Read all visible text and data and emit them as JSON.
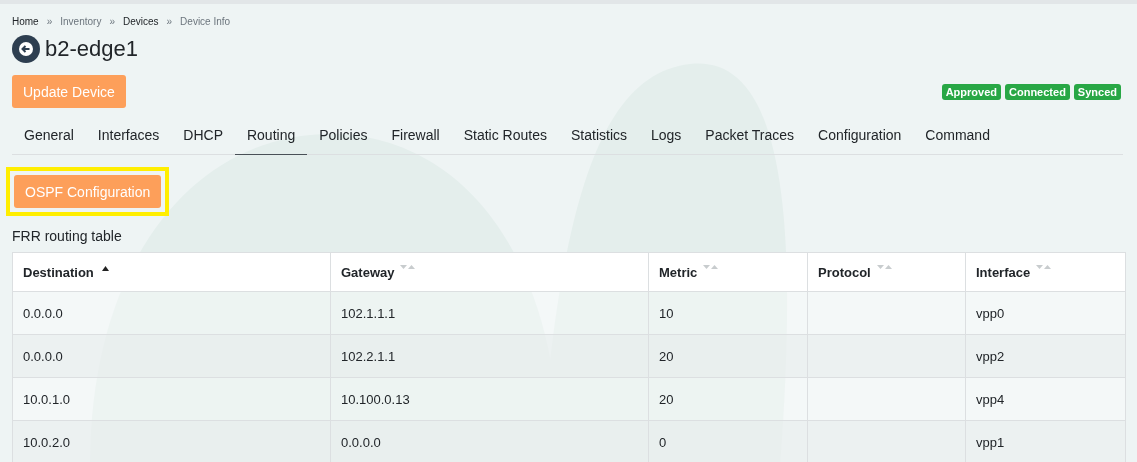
{
  "breadcrumbs": [
    {
      "label": "Home",
      "link": true
    },
    {
      "label": "»",
      "link": false
    },
    {
      "label": "Inventory",
      "link": false
    },
    {
      "label": "»",
      "link": false
    },
    {
      "label": "Devices",
      "link": true
    },
    {
      "label": "»",
      "link": false
    },
    {
      "label": "Device Info",
      "link": false
    }
  ],
  "title": "b2-edge1",
  "update_button": "Update Device",
  "badges": [
    "Approved",
    "Connected",
    "Synced"
  ],
  "tabs": [
    {
      "label": "General",
      "selected": false
    },
    {
      "label": "Interfaces",
      "selected": false
    },
    {
      "label": "DHCP",
      "selected": false
    },
    {
      "label": "Routing",
      "selected": true
    },
    {
      "label": "Policies",
      "selected": false
    },
    {
      "label": "Firewall",
      "selected": false
    },
    {
      "label": "Static Routes",
      "selected": false
    },
    {
      "label": "Statistics",
      "selected": false
    },
    {
      "label": "Logs",
      "selected": false
    },
    {
      "label": "Packet Traces",
      "selected": false
    },
    {
      "label": "Configuration",
      "selected": false
    },
    {
      "label": "Command",
      "selected": false
    }
  ],
  "ospf_button": {
    "label": "OSPF Configuration",
    "highlighted": true
  },
  "table": {
    "caption": "FRR routing table",
    "columns": [
      {
        "label": "Destination",
        "sorted": true
      },
      {
        "label": "Gateway",
        "sorted": false
      },
      {
        "label": "Metric",
        "sorted": false
      },
      {
        "label": "Protocol",
        "sorted": false
      },
      {
        "label": "Interface",
        "sorted": false
      }
    ],
    "rows": [
      [
        "0.0.0.0",
        "102.1.1.1",
        "10",
        "",
        "vpp0"
      ],
      [
        "0.0.0.0",
        "102.2.1.1",
        "20",
        "",
        "vpp2"
      ],
      [
        "10.0.1.0",
        "10.100.0.13",
        "20",
        "",
        "vpp4"
      ],
      [
        "10.0.2.0",
        "0.0.0.0",
        "0",
        "",
        "vpp1"
      ]
    ]
  }
}
